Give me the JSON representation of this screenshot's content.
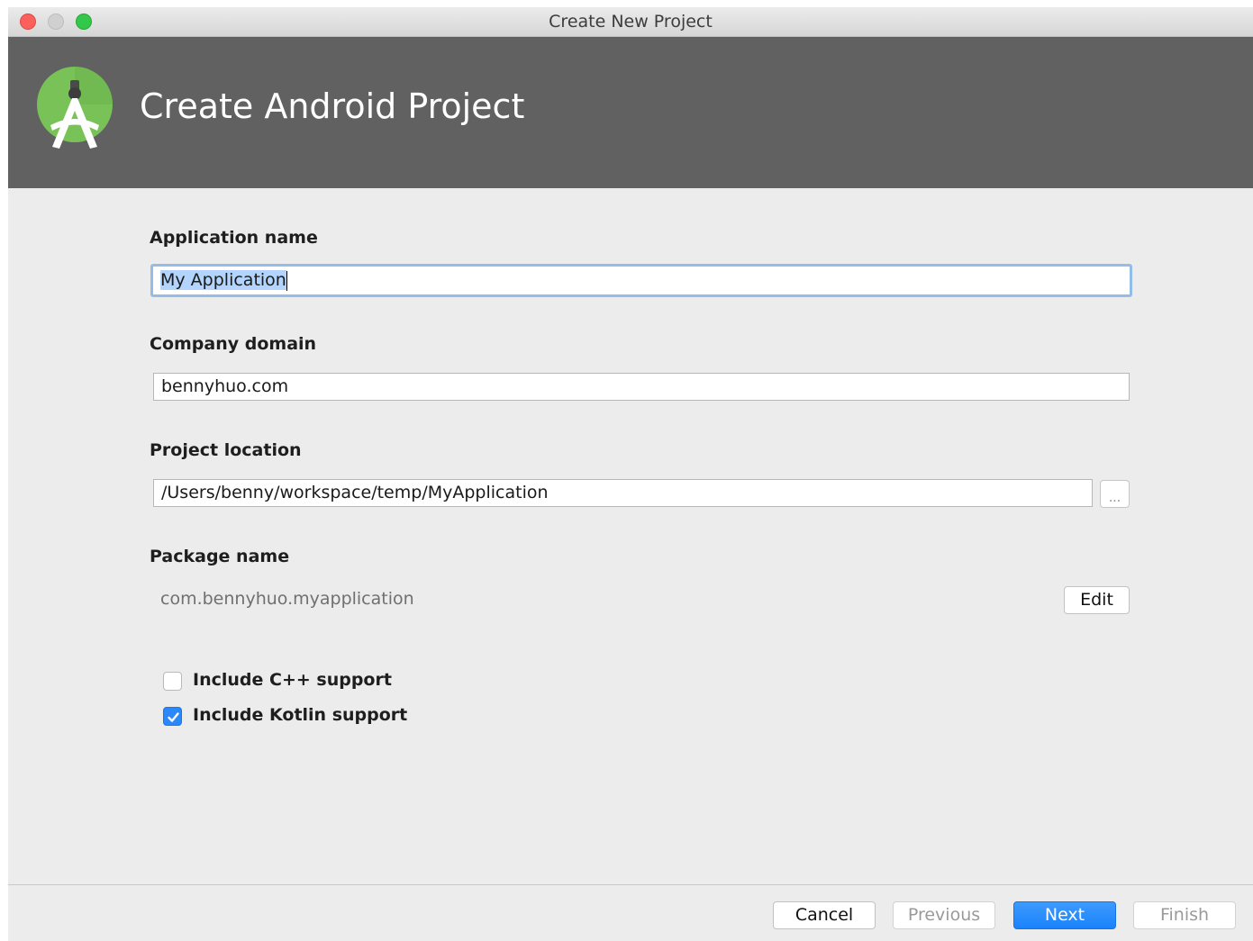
{
  "window": {
    "title": "Create New Project"
  },
  "header": {
    "title": "Create Android Project",
    "logo_icon": "android-studio-logo-icon"
  },
  "form": {
    "application_name": {
      "label": "Application name",
      "value": "My Application"
    },
    "company_domain": {
      "label": "Company domain",
      "value": "bennyhuo.com"
    },
    "project_location": {
      "label": "Project location",
      "value": "/Users/benny/workspace/temp/MyApplication",
      "browse_label": "..."
    },
    "package_name": {
      "label": "Package name",
      "value": "com.bennyhuo.myapplication",
      "edit_label": "Edit"
    }
  },
  "options": {
    "cpp_support": {
      "label": "Include C++ support",
      "checked": false
    },
    "kotlin_support": {
      "label": "Include Kotlin support",
      "checked": true
    }
  },
  "footer": {
    "cancel_label": "Cancel",
    "previous_label": "Previous",
    "next_label": "Next",
    "finish_label": "Finish"
  },
  "colors": {
    "header_bg": "#616161",
    "primary_button": "#1a82fb",
    "focus_ring": "#93bde9",
    "logo_green": "#78c257"
  }
}
